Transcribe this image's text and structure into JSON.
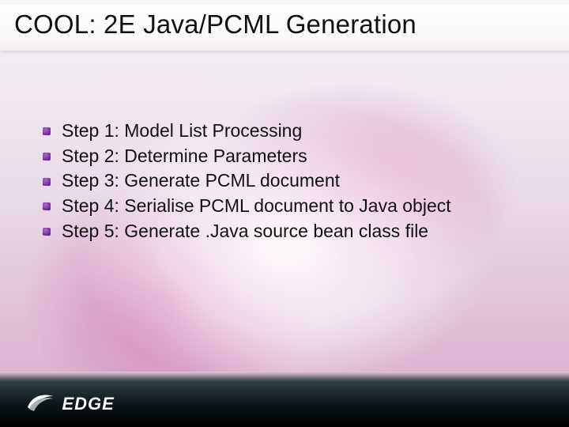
{
  "title": "COOL: 2E Java/PCML Generation",
  "bullets": [
    "Step 1: Model List Processing",
    "Step 2: Determine Parameters",
    "Step 3: Generate PCML document",
    "Step 4: Serialise PCML document to Java object",
    "Step 5: Generate .Java source bean class file"
  ],
  "brand": "EDGE"
}
